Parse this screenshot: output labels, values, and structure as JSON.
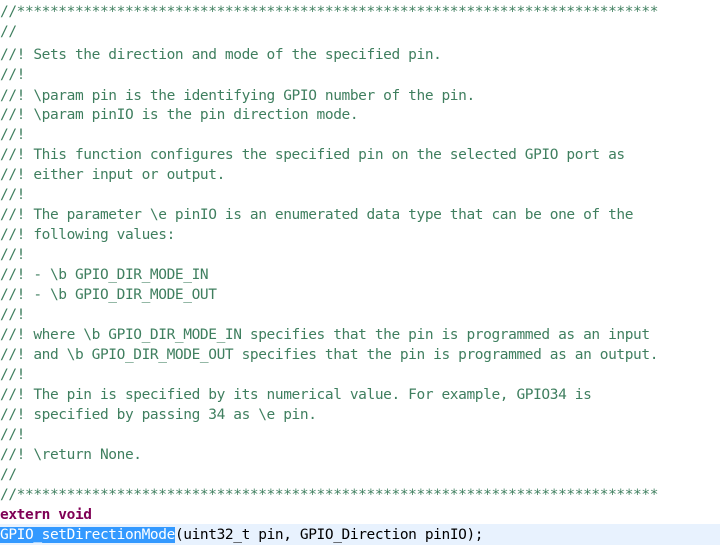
{
  "editor": {
    "comment_lines": [
      "//*****************************************************************************",
      "//",
      "//! Sets the direction and mode of the specified pin.",
      "//!",
      "//! \\param pin is the identifying GPIO number of the pin.",
      "//! \\param pinIO is the pin direction mode.",
      "//!",
      "//! This function configures the specified pin on the selected GPIO port as",
      "//! either input or output.",
      "//!",
      "//! The parameter \\e pinIO is an enumerated data type that can be one of the",
      "//! following values:",
      "//!",
      "//! - \\b GPIO_DIR_MODE_IN",
      "//! - \\b GPIO_DIR_MODE_OUT",
      "//!",
      "//! where \\b GPIO_DIR_MODE_IN specifies that the pin is programmed as an input",
      "//! and \\b GPIO_DIR_MODE_OUT specifies that the pin is programmed as an output.",
      "//!",
      "//! The pin is specified by its numerical value. For example, GPIO34 is",
      "//! specified by passing 34 as \\e pin.",
      "//!",
      "//! \\return None.",
      "//",
      "//*****************************************************************************"
    ],
    "keyword_line": "extern void",
    "function_name": "GPIO_setDirectionMode",
    "function_params": "(uint32_t pin, GPIO_Direction pinIO);"
  }
}
